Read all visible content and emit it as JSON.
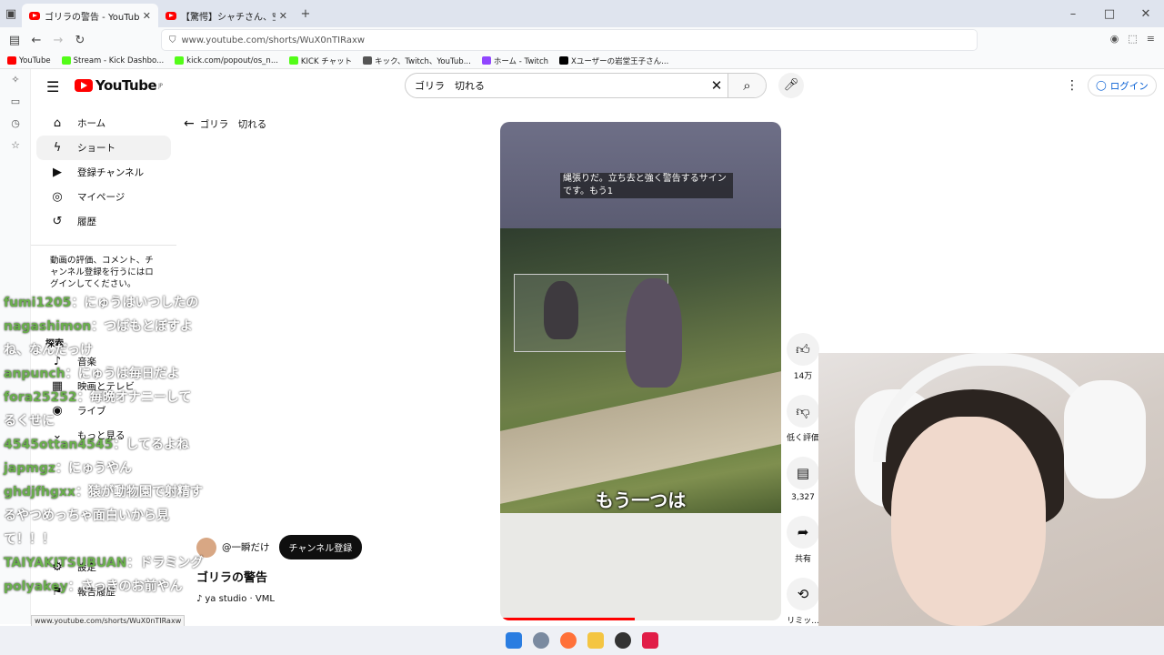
{
  "browser": {
    "tabs": [
      {
        "label": "ゴリラの警告 - YouTube",
        "active": true
      },
      {
        "label": "【驚愕】シャチさん、空中に逃げ",
        "active": false
      }
    ],
    "url": "www.youtube.com/shorts/WuX0nTIRaxw",
    "bookmarks": [
      "YouTube",
      "Stream - Kick Dashbo...",
      "kick.com/popout/os_n...",
      "KICK チャット",
      "キック、Twitch、YouTub...",
      "ホーム - Twitch",
      "Xユーザーの岩堂王子さん..."
    ],
    "status_url": "www.youtube.com/shorts/WuX0nTIRaxw"
  },
  "header": {
    "logo": "YouTube",
    "logo_region": "JP",
    "search_value": "ゴリラ　切れる",
    "login": "ログイン"
  },
  "sidebar": {
    "items": [
      {
        "label": "ホーム",
        "icon": "home-icon"
      },
      {
        "label": "ショート",
        "icon": "shorts-icon",
        "selected": true
      },
      {
        "label": "登録チャンネル",
        "icon": "subscriptions-icon"
      },
      {
        "label": "マイページ",
        "icon": "you-icon"
      },
      {
        "label": "履歴",
        "icon": "history-icon"
      }
    ],
    "signin_prompt": "動画の評価、コメント、チャンネル登録を行うにはログインしてください。",
    "explore_heading": "探索",
    "explore_items": [
      "音楽",
      "映画とテレビ",
      "ライブ",
      "もっと見る"
    ],
    "footer_items": [
      "設定",
      "報告履歴"
    ]
  },
  "shorts": {
    "back_label": "ゴリラ　切れる",
    "caption": "縄張りだ。立ち去と強く警告するサインです。もう1",
    "subtitle": "もう一つは",
    "channel": "@一瞬だけ",
    "subscribe": "チャンネル登録",
    "title": "ゴリラの警告",
    "audio": "ya studio · VML",
    "progress": 0.48,
    "actions": {
      "like": "14万",
      "dislike": "低く評価",
      "comments": "3,327",
      "share": "共有",
      "remix": "リミッ..."
    }
  },
  "chat": [
    {
      "user": "fumi1205",
      "msg": "：にゅうはいつしたの"
    },
    {
      "user": "nagashimon",
      "msg": "：つばもとぼすよね、なんだっけ"
    },
    {
      "user": "anpunch",
      "msg": "：にゅうは毎日だよ"
    },
    {
      "user": "fora25252",
      "msg": "：毎晩オナニーしてるくせに"
    },
    {
      "user": "4545ottan4545",
      "msg": "：してるよね"
    },
    {
      "user": "japmgz",
      "msg": "：にゅうやん"
    },
    {
      "user": "ghdjfhgxx",
      "msg": "：猿が動物園で射精するやつめっちゃ面白いから見て！！！"
    },
    {
      "user": "TAIYAKITSUBUAN",
      "msg": "：ドラミング"
    },
    {
      "user": "polyakey",
      "msg": "：さっきのお前やん"
    }
  ],
  "colors": {
    "accent": "#ff0000",
    "chat_name": "#6ab04c"
  }
}
